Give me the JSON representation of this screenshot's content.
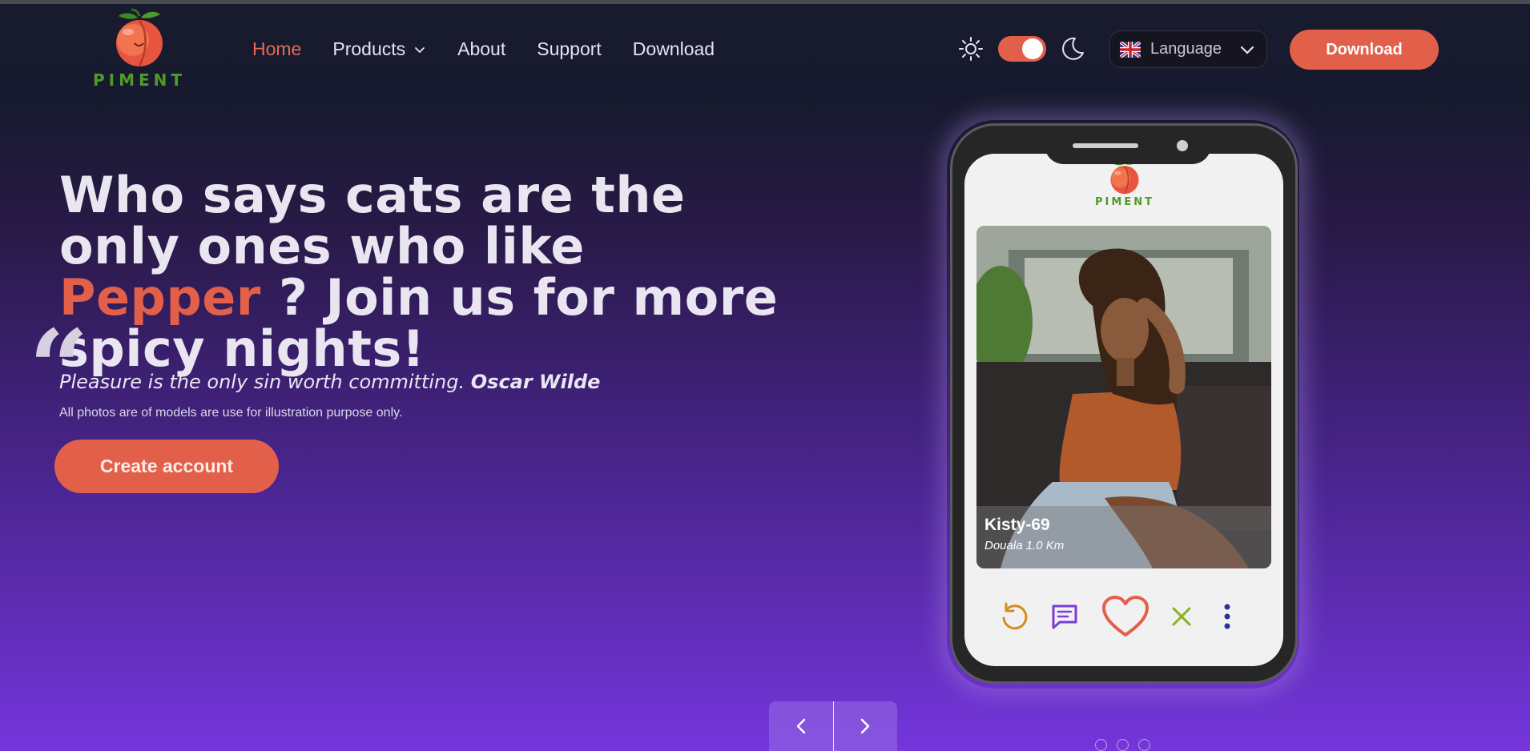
{
  "brand": {
    "name": "PIMENT",
    "accent": "#e2604a",
    "green": "#4f9b2a"
  },
  "nav": {
    "items": [
      {
        "label": "Home",
        "active": true
      },
      {
        "label": "Products",
        "dropdown": true
      },
      {
        "label": "About"
      },
      {
        "label": "Support"
      },
      {
        "label": "Download"
      }
    ]
  },
  "theme": {
    "light_icon": "sun-icon",
    "dark_icon": "moon-icon",
    "toggle_on": true
  },
  "language": {
    "label": "Language",
    "flag_icon": "uk-flag-icon"
  },
  "header": {
    "download_label": "Download"
  },
  "hero": {
    "headline_before": "Who says cats are the only ones who like ",
    "headline_accent": "Pepper",
    "headline_after": " ? Join us for more spicy nights!",
    "quote_text": "Pleasure is the only sin worth committing.",
    "quote_author": "Oscar Wilde",
    "disclaimer": "All photos are of models are use for illustration purpose only.",
    "cta_label": "Create account"
  },
  "phone": {
    "app_name": "PIMENT",
    "profile": {
      "name": "Kisty-69",
      "location": "Douala 1.0 Km"
    },
    "actions": [
      "undo-icon",
      "chat-icon",
      "heart-icon",
      "close-icon",
      "more-icon"
    ]
  },
  "carousel": {
    "prev_icon": "chevron-left-icon",
    "next_icon": "chevron-right-icon",
    "dots": 3
  }
}
